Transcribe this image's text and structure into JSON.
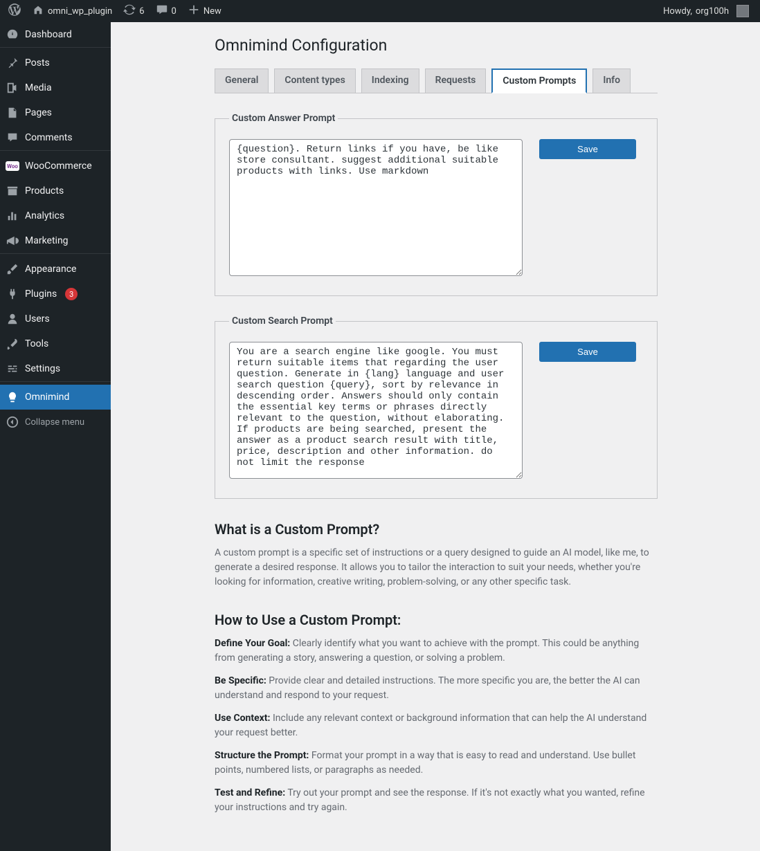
{
  "adminbar": {
    "site_name": "omni_wp_plugin",
    "updates_count": "6",
    "comments_count": "0",
    "new_label": "New",
    "howdy_prefix": "Howdy, ",
    "user_name": "org100h"
  },
  "sidebar": {
    "items": [
      {
        "id": "dashboard",
        "label": "Dashboard",
        "icon": "dashboard"
      },
      {
        "id": "sep"
      },
      {
        "id": "posts",
        "label": "Posts",
        "icon": "pin"
      },
      {
        "id": "media",
        "label": "Media",
        "icon": "media"
      },
      {
        "id": "pages",
        "label": "Pages",
        "icon": "page"
      },
      {
        "id": "comments",
        "label": "Comments",
        "icon": "comment"
      },
      {
        "id": "sep"
      },
      {
        "id": "woocommerce",
        "label": "WooCommerce",
        "icon": "woo"
      },
      {
        "id": "products",
        "label": "Products",
        "icon": "archive"
      },
      {
        "id": "analytics",
        "label": "Analytics",
        "icon": "bars"
      },
      {
        "id": "marketing",
        "label": "Marketing",
        "icon": "megaphone"
      },
      {
        "id": "sep"
      },
      {
        "id": "appearance",
        "label": "Appearance",
        "icon": "brush"
      },
      {
        "id": "plugins",
        "label": "Plugins",
        "icon": "plug",
        "badge": "3"
      },
      {
        "id": "users",
        "label": "Users",
        "icon": "user"
      },
      {
        "id": "tools",
        "label": "Tools",
        "icon": "wrench"
      },
      {
        "id": "settings",
        "label": "Settings",
        "icon": "sliders"
      },
      {
        "id": "sep"
      },
      {
        "id": "omnimind",
        "label": "Omnimind",
        "icon": "bulb",
        "active": true
      },
      {
        "id": "collapse",
        "label": "Collapse menu",
        "icon": "collapse",
        "collapse": true
      }
    ]
  },
  "page": {
    "title": "Omnimind Configuration",
    "tabs": [
      {
        "id": "general",
        "label": "General"
      },
      {
        "id": "content_types",
        "label": "Content types"
      },
      {
        "id": "indexing",
        "label": "Indexing"
      },
      {
        "id": "requests",
        "label": "Requests"
      },
      {
        "id": "custom_prompts",
        "label": "Custom Prompts",
        "active": true
      },
      {
        "id": "info",
        "label": "Info"
      }
    ],
    "answer_group_legend": "Custom Answer Prompt",
    "search_group_legend": "Custom Search Prompt",
    "answer_prompt": "{question}. Return links if you have, be like store consultant. suggest additional suitable products with links. Use markdown",
    "search_prompt": "You are a search engine like google. You must return suitable items that regarding the user question. Generate in {lang} language and user search question {query}, sort by relevance in descending order. Answers should only contain the essential key terms or phrases directly relevant to the question, without elaborating. If products are being searched, present the answer as a product search result with title, price, description and other information. do not limit the response",
    "save_label": "Save",
    "doc": {
      "h1": "What is a Custom Prompt?",
      "p1": "A custom prompt is a specific set of instructions or a query designed to guide an AI model, like me, to generate a desired response. It allows you to tailor the interaction to suit your needs, whether you're looking for information, creative writing, problem-solving, or any other specific task.",
      "h2": "How to Use a Custom Prompt:",
      "b1": "Define Your Goal:",
      "t1": " Clearly identify what you want to achieve with the prompt. This could be anything from generating a story, answering a question, or solving a problem.",
      "b2": "Be Specific:",
      "t2": " Provide clear and detailed instructions. The more specific you are, the better the AI can understand and respond to your request.",
      "b3": "Use Context:",
      "t3": " Include any relevant context or background information that can help the AI understand your request better.",
      "b4": "Structure the Prompt:",
      "t4": " Format your prompt in a way that is easy to read and understand. Use bullet points, numbered lists, or paragraphs as needed.",
      "b5": "Test and Refine:",
      "t5": " Try out your prompt and see the response. If it's not exactly what you wanted, refine your instructions and try again."
    }
  }
}
